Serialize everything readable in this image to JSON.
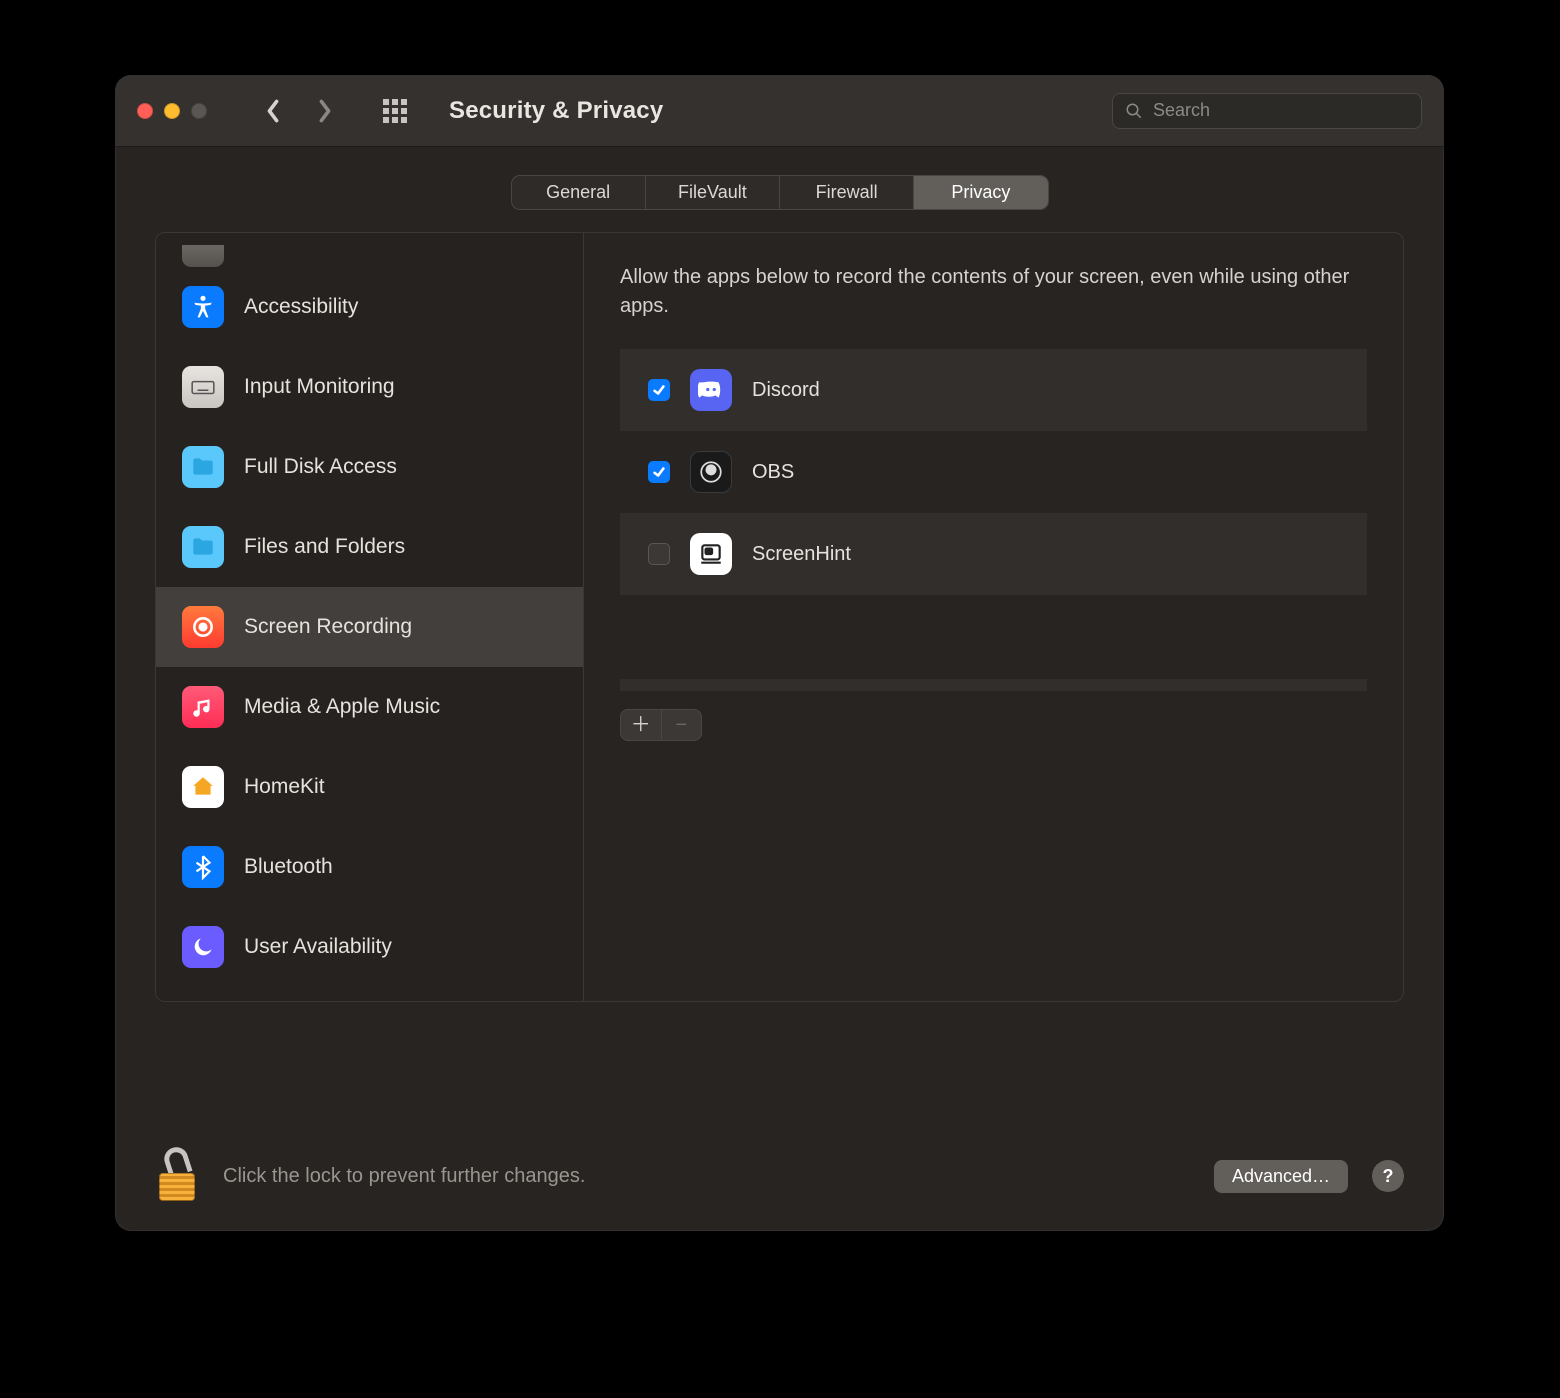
{
  "window": {
    "title": "Security & Privacy"
  },
  "search": {
    "placeholder": "Search",
    "value": ""
  },
  "tabs": [
    {
      "label": "General",
      "active": false
    },
    {
      "label": "FileVault",
      "active": false
    },
    {
      "label": "Firewall",
      "active": false
    },
    {
      "label": "Privacy",
      "active": true
    }
  ],
  "sidebar": {
    "items": [
      {
        "label": "Accessibility",
        "icon": "accessibility-icon"
      },
      {
        "label": "Input Monitoring",
        "icon": "keyboard-icon"
      },
      {
        "label": "Full Disk Access",
        "icon": "folder-icon"
      },
      {
        "label": "Files and Folders",
        "icon": "folder-icon"
      },
      {
        "label": "Screen Recording",
        "icon": "record-icon",
        "selected": true
      },
      {
        "label": "Media & Apple Music",
        "icon": "music-icon"
      },
      {
        "label": "HomeKit",
        "icon": "home-icon"
      },
      {
        "label": "Bluetooth",
        "icon": "bluetooth-icon"
      },
      {
        "label": "User Availability",
        "icon": "moon-icon"
      }
    ]
  },
  "main": {
    "description": "Allow the apps below to record the contents of your screen, even while using other apps.",
    "apps": [
      {
        "name": "Discord",
        "checked": true,
        "icon": "discord-icon"
      },
      {
        "name": "OBS",
        "checked": true,
        "icon": "obs-icon"
      },
      {
        "name": "ScreenHint",
        "checked": false,
        "icon": "screenhint-icon"
      }
    ]
  },
  "footer": {
    "lock_text": "Click the lock to prevent further changes.",
    "advanced_label": "Advanced…",
    "help_label": "?"
  }
}
